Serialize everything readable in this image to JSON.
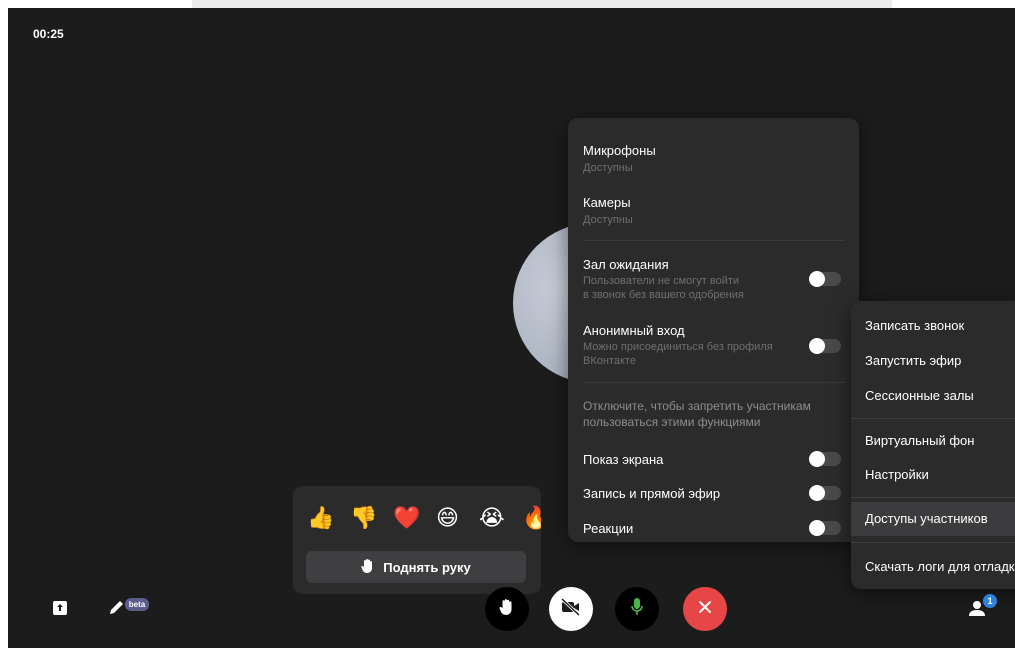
{
  "call": {
    "timer": "00:25"
  },
  "permissions_panel": {
    "microphones": {
      "title": "Микрофоны",
      "status": "Доступны"
    },
    "cameras": {
      "title": "Камеры",
      "status": "Доступны"
    },
    "waiting_room": {
      "title": "Зал ожидания",
      "desc_line1": "Пользователи не смогут войти",
      "desc_line2": "в звонок без вашего одобрения",
      "enabled": false
    },
    "anonymous_entry": {
      "title": "Анонимный вход",
      "desc_line1": "Можно присоединиться без профиля",
      "desc_line2": "ВКонтакте",
      "enabled": false
    },
    "note_line1": "Отключите, чтобы запретить участникам",
    "note_line2": "пользоваться этими функциями",
    "rows": [
      {
        "label": "Показ экрана",
        "enabled": false
      },
      {
        "label": "Запись и прямой эфир",
        "enabled": false
      },
      {
        "label": "Реакции",
        "enabled": false
      }
    ]
  },
  "context_menu": {
    "items": [
      {
        "label": "Записать звонок"
      },
      {
        "label": "Запустить эфир"
      },
      {
        "label": "Сессионные залы"
      },
      {
        "label": "Виртуальный фон"
      },
      {
        "label": "Настройки"
      },
      {
        "label": "Доступы участников",
        "active": true
      },
      {
        "label": "Скачать логи для отладки"
      }
    ]
  },
  "reactions": {
    "emojis": [
      "👍",
      "👎",
      "❤️",
      "😄",
      "😭",
      "🔥"
    ],
    "raise_hand_label": "Поднять руку"
  },
  "toolbar": {
    "beta_label": "beta",
    "participants_count": "1",
    "end_call_color": "#e64646",
    "mic_color": "#4bb34b"
  },
  "icons": {
    "share": "share-screen-icon",
    "draw": "pencil-icon",
    "hand": "raise-hand-icon",
    "camera_off": "camera-off-icon",
    "mic": "microphone-icon",
    "end": "end-call-icon",
    "participants": "participants-icon"
  }
}
